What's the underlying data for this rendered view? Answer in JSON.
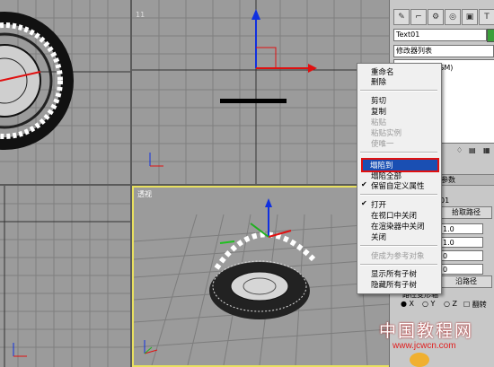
{
  "viewports": {
    "perspective_label": "透视",
    "top_right_label": "11"
  },
  "panel": {
    "object_name": "Text01",
    "modifier_list": "修改器列表",
    "stack_item": "变形/绑定 (WSM)",
    "params_header": "参数",
    "row1": "01",
    "pick_path_button": "拾取路径",
    "spinner1": "1.0",
    "spinner2": "1.0",
    "spinner3": "0",
    "spinner4": "0",
    "along_path_button": "沿路径",
    "path_deform_axis": "路径变形轴",
    "axis_x": "X",
    "axis_y": "Y",
    "axis_z": "Z",
    "flip": "翻转"
  },
  "context_menu": {
    "items": [
      {
        "label": "重命名",
        "enabled": true
      },
      {
        "label": "删除",
        "enabled": true
      },
      {
        "label": "剪切",
        "enabled": true
      },
      {
        "label": "复制",
        "enabled": true
      },
      {
        "label": "粘贴",
        "enabled": false
      },
      {
        "label": "粘贴实例",
        "enabled": false
      },
      {
        "label": "使唯一",
        "enabled": false
      },
      {
        "label": "塌陷到",
        "enabled": true,
        "highlighted": true
      },
      {
        "label": "塌陷全部",
        "enabled": true
      },
      {
        "label": "保留自定义属性",
        "enabled": true,
        "checked": true
      },
      {
        "label": "打开",
        "enabled": true,
        "checked": true
      },
      {
        "label": "在视口中关闭",
        "enabled": true
      },
      {
        "label": "在渲染器中关闭",
        "enabled": true
      },
      {
        "label": "关闭",
        "enabled": true
      },
      {
        "label": "使成为参考对象",
        "enabled": false
      },
      {
        "label": "显示所有子树",
        "enabled": true
      },
      {
        "label": "隐藏所有子树",
        "enabled": true
      }
    ]
  },
  "watermark": {
    "title": "中国教程网",
    "url": "www.jcwcn.com"
  },
  "colors": {
    "highlight": "#1a4fb3",
    "highlight_border": "#e01010",
    "active_viewport_border": "#e8e060",
    "viewport_bg": "#9b9b9b"
  }
}
